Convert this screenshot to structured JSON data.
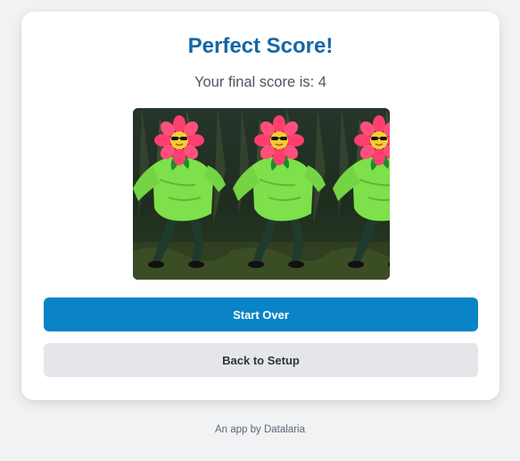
{
  "result": {
    "title": "Perfect Score!",
    "score_text": "Your final score is: 4",
    "image_icon": "dancing-flower-costume-gif"
  },
  "actions": {
    "start_over_label": "Start Over",
    "back_to_setup_label": "Back to Setup"
  },
  "footer": {
    "credit": "An app by Datalaria"
  },
  "colors": {
    "title": "#1467a6",
    "primary_button": "#0a84c6",
    "secondary_button": "#e4e6ea",
    "page_background": "#f1f2f4"
  }
}
